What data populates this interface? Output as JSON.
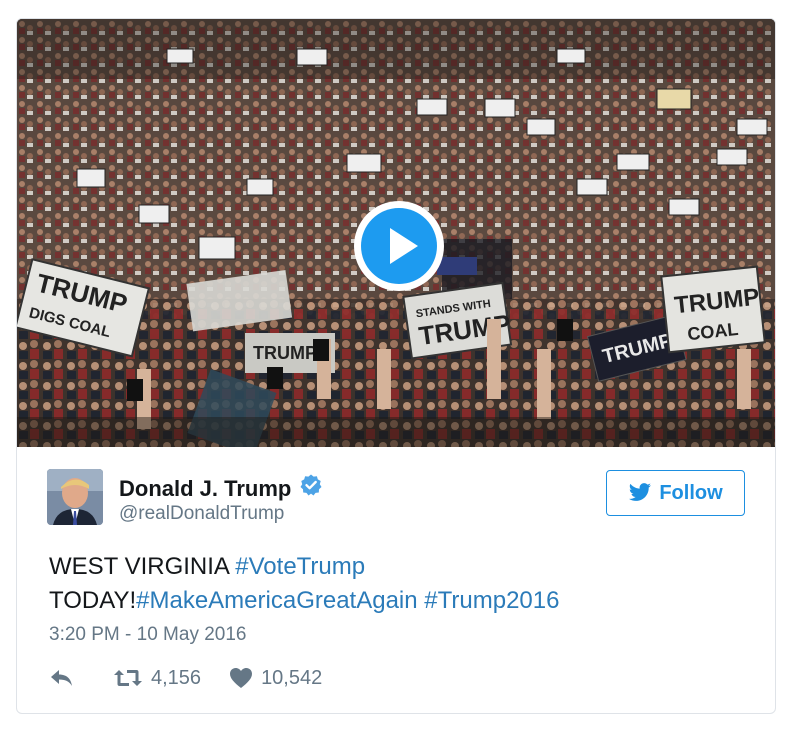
{
  "media": {
    "sign_texts": [
      "TRUMP",
      "DIGS COAL",
      "TRUMP",
      "STANDS WITH",
      "TRUMP",
      "TRUMP",
      "COAL"
    ],
    "play_icon": "play-icon"
  },
  "author": {
    "name": "Donald J. Trump",
    "handle": "@realDonaldTrump",
    "verified_icon": "verified-badge-icon"
  },
  "follow": {
    "label": "Follow",
    "icon": "twitter-bird-icon",
    "color": "#1d8fe0"
  },
  "tweet": {
    "line1_text": "WEST VIRGINIA ",
    "line1_tag": "#VoteTrump",
    "line2_text": "TODAY!",
    "line2_tag1": "#MakeAmericaGreatAgain",
    "line2_tag2": "#Trump2016",
    "hashtag_color": "#2b7bb9"
  },
  "timestamp": "3:20 PM - 10 May 2016",
  "actions": {
    "reply_icon": "reply-icon",
    "retweet_icon": "retweet-icon",
    "retweet_count": "4,156",
    "like_icon": "heart-icon",
    "like_count": "10,542"
  }
}
